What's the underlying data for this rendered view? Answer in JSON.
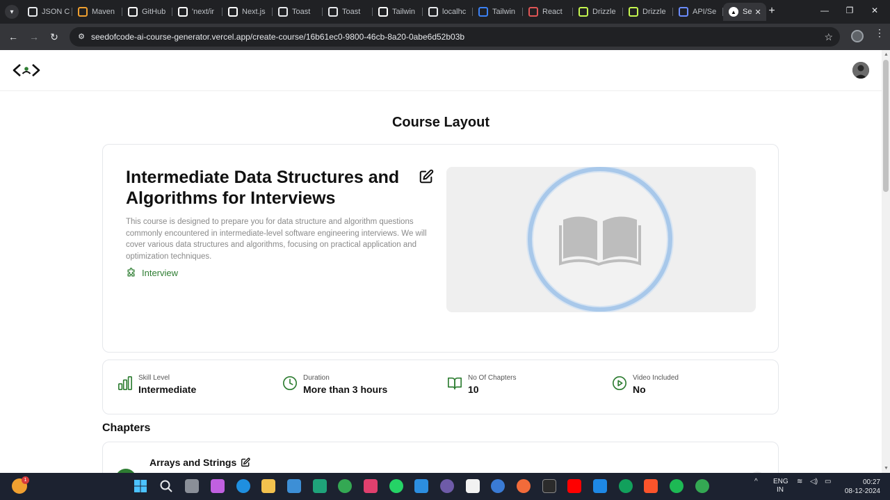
{
  "browser": {
    "tabs": [
      {
        "title": "JSON C",
        "color": "#e8eaed"
      },
      {
        "title": "Maven",
        "color": "#f0a030"
      },
      {
        "title": "GitHub",
        "color": "#ffffff"
      },
      {
        "title": "'next/ir",
        "color": "#ffffff"
      },
      {
        "title": "Next.js",
        "color": "#ffffff"
      },
      {
        "title": "Toast",
        "color": "#e8eaed"
      },
      {
        "title": "Toast",
        "color": "#e8eaed"
      },
      {
        "title": "Tailwin",
        "color": "#ffffff"
      },
      {
        "title": "localhc",
        "color": "#e8eaed"
      },
      {
        "title": "Tailwin",
        "color": "#3b82f6"
      },
      {
        "title": "React",
        "color": "#e05555"
      },
      {
        "title": "Drizzle",
        "color": "#c5f74f"
      },
      {
        "title": "Drizzle",
        "color": "#c5f74f"
      },
      {
        "title": "API/Se",
        "color": "#6b8cff"
      }
    ],
    "active_tab": {
      "title": "Se"
    },
    "new_tab": "+",
    "url": "seedofcode-ai-course-generator.vercel.app/create-course/16b61ec0-9800-46cb-8a20-0abe6d52b03b"
  },
  "page": {
    "title": "Course Layout",
    "course": {
      "name": "Intermediate Data Structures and Algorithms for Interviews",
      "description": "This course is designed to prepare you for data structure and algorithm questions commonly encountered in intermediate-level software engineering interviews. We will cover various data structures and algorithms, focusing on practical application and optimization techniques.",
      "category": "Interview"
    },
    "stats": [
      {
        "label": "Skill Level",
        "value": "Intermediate",
        "icon": "bar-chart-icon"
      },
      {
        "label": "Duration",
        "value": "More than 3 hours",
        "icon": "clock-icon"
      },
      {
        "label": "No Of Chapters",
        "value": "10",
        "icon": "book-open-icon"
      },
      {
        "label": "Video Included",
        "value": "No",
        "icon": "play-circle-icon"
      }
    ],
    "chapters_heading": "Chapters",
    "chapters": [
      {
        "title": "Arrays and Strings"
      }
    ]
  },
  "taskbar": {
    "weather_badge": "1",
    "lang": "ENG",
    "region": "IN",
    "time": "00:27",
    "date": "08-12-2024"
  },
  "colors": {
    "accent": "#2e7d32",
    "chrome_dark": "#202124",
    "chrome_toolbar": "#35363a"
  }
}
